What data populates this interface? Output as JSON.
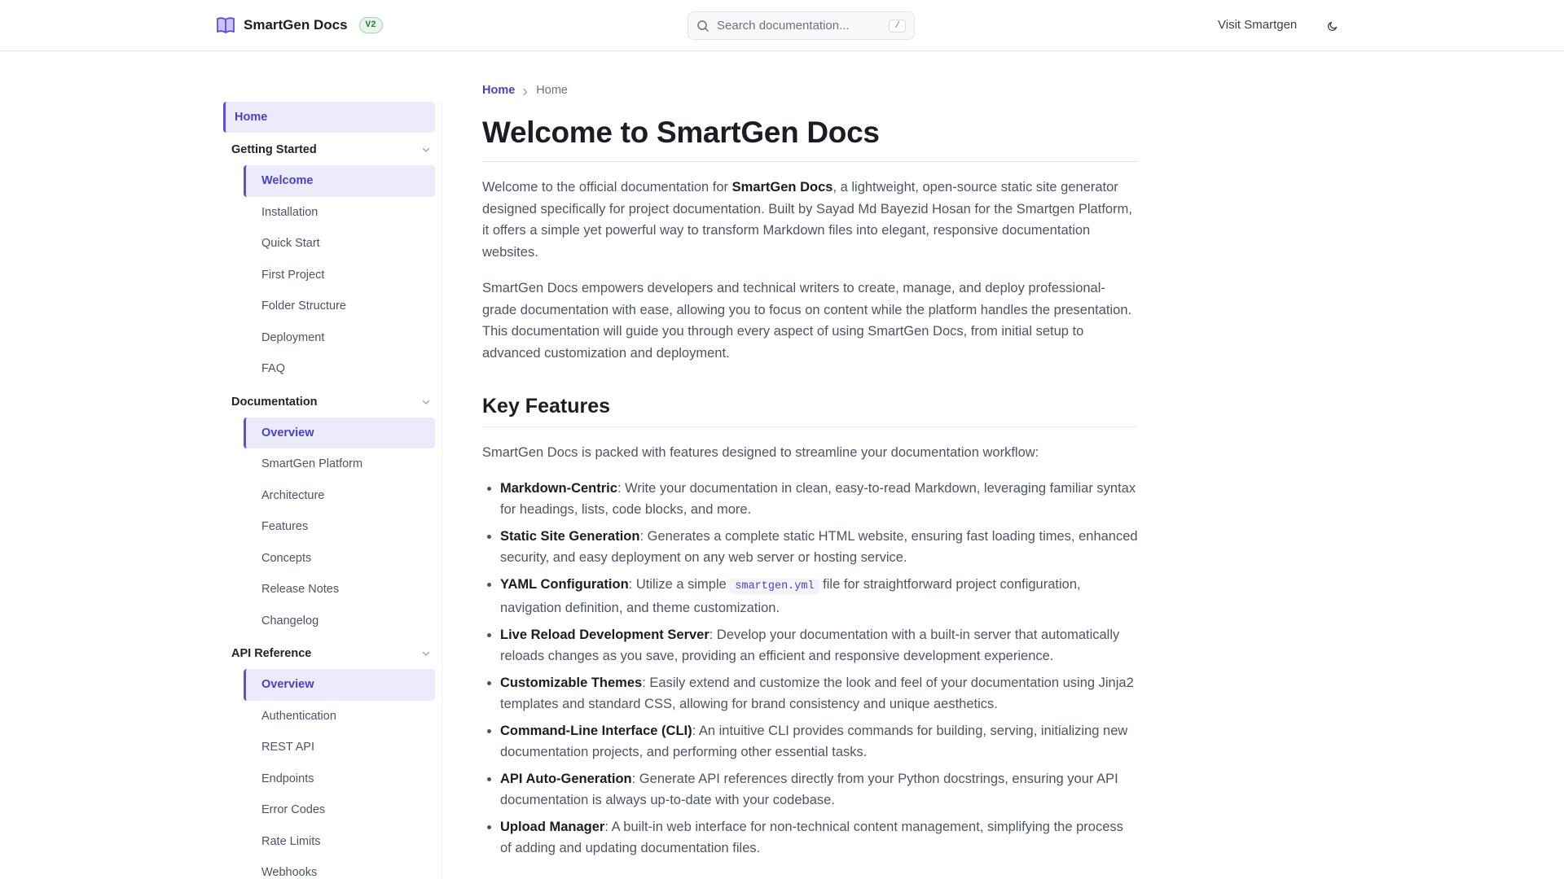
{
  "header": {
    "brand_name": "SmartGen Docs",
    "version_badge": "V2",
    "search_placeholder": "Search documentation...",
    "search_shortcut": "/",
    "visit_link": "Visit Smartgen"
  },
  "sidebar": {
    "home": "Home",
    "groups": [
      {
        "title": "Getting Started",
        "items": [
          "Welcome",
          "Installation",
          "Quick Start",
          "First Project",
          "Folder Structure",
          "Deployment",
          "FAQ"
        ]
      },
      {
        "title": "Documentation",
        "items": [
          "Overview",
          "SmartGen Platform",
          "Architecture",
          "Features",
          "Concepts",
          "Release Notes",
          "Changelog"
        ]
      },
      {
        "title": "API Reference",
        "items": [
          "Overview",
          "Authentication",
          "REST API",
          "Endpoints",
          "Error Codes",
          "Rate Limits",
          "Webhooks"
        ]
      }
    ]
  },
  "main": {
    "breadcrumb": {
      "home": "Home",
      "current": "Home"
    },
    "title": "Welcome to SmartGen Docs",
    "intro1": {
      "before": "Welcome to the official documentation for ",
      "bold": "SmartGen Docs",
      "after": ", a lightweight, open-source static site generator designed specifically for project documentation. Built by Sayad Md Bayezid Hosan for the Smartgen Platform, it offers a simple yet powerful way to transform Markdown files into elegant, responsive documentation websites."
    },
    "intro2": "SmartGen Docs empowers developers and technical writers to create, manage, and deploy professional-grade documentation with ease, allowing you to focus on content while the platform handles the presentation. This documentation will guide you through every aspect of using SmartGen Docs, from initial setup to advanced customization and deployment.",
    "features_heading": "Key Features",
    "features_intro": "SmartGen Docs is packed with features designed to streamline your documentation workflow:",
    "features": [
      {
        "name": "Markdown-Centric",
        "desc": ": Write your documentation in clean, easy-to-read Markdown, leveraging familiar syntax for headings, lists, code blocks, and more."
      },
      {
        "name": "Static Site Generation",
        "desc": ": Generates a complete static HTML website, ensuring fast loading times, enhanced security, and easy deployment on any web server or hosting service."
      },
      {
        "name": "YAML Configuration",
        "desc_before": ": Utilize a simple ",
        "code": "smartgen.yml",
        "desc": " file for straightforward project configuration, navigation definition, and theme customization."
      },
      {
        "name": "Live Reload Development Server",
        "desc": ": Develop your documentation with a built-in server that automatically reloads changes as you save, providing an efficient and responsive development experience."
      },
      {
        "name": "Customizable Themes",
        "desc": ": Easily extend and customize the look and feel of your documentation using Jinja2 templates and standard CSS, allowing for brand consistency and unique aesthetics."
      },
      {
        "name": "Command-Line Interface (CLI)",
        "desc": ": An intuitive CLI provides commands for building, serving, initializing new documentation projects, and performing other essential tasks."
      },
      {
        "name": "API Auto-Generation",
        "desc": ": Generate API references directly from your Python docstrings, ensuring your API documentation is always up-to-date with your codebase."
      },
      {
        "name": "Upload Manager",
        "desc": ": A built-in web interface for non-technical content management, simplifying the process of adding and updating documentation files."
      }
    ]
  },
  "colors": {
    "accent": "#5b4fd6",
    "accent_text": "#4b3fc9",
    "active_bg": "#ecebfb",
    "badge_green": "#2f7a4a"
  },
  "icons": {
    "brand": "book-open-icon",
    "search": "search-icon",
    "theme": "moon-icon",
    "chevron": "chevron-down-icon",
    "breadcrumb": "chevron-right-icon"
  }
}
